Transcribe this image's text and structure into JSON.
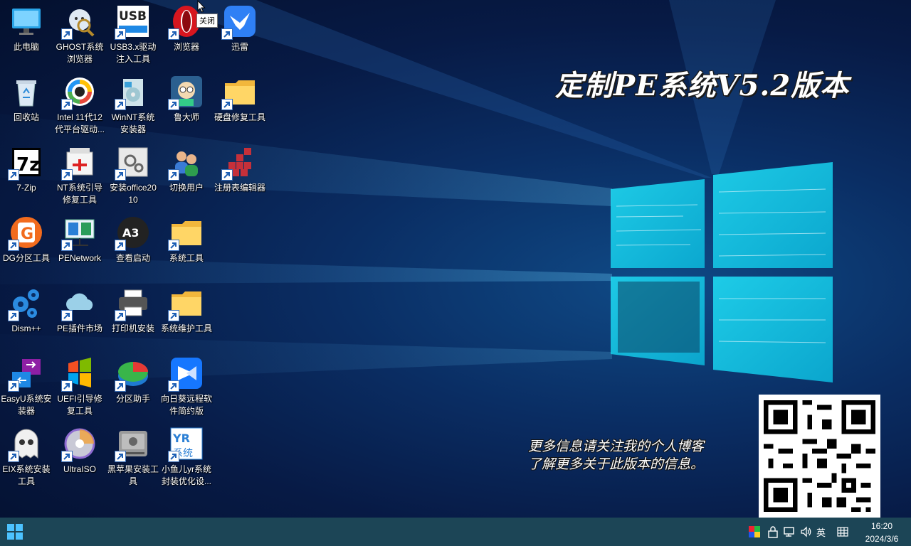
{
  "wallpaper": {
    "title": "定制PE系统V5.2版本",
    "blog_line1": "更多信息请关注我的个人博客",
    "blog_line2": "了解更多关于此版本的信息。"
  },
  "tooltip": "关闭",
  "desktop_icons": [
    {
      "label": "此电脑",
      "icon": "monitor-icon"
    },
    {
      "label": "GHOST系统浏览器",
      "icon": "ghost-explorer-icon"
    },
    {
      "label": "USB3.x驱动注入工具",
      "icon": "usb3-icon"
    },
    {
      "label": "浏览器",
      "icon": "opera-icon"
    },
    {
      "label": "迅雷",
      "icon": "thunder-icon"
    },
    {
      "label": "回收站",
      "icon": "recycle-bin-icon"
    },
    {
      "label": "Intel 11代12代平台驱动...",
      "icon": "intel-driver-icon"
    },
    {
      "label": "WinNT系统安装器",
      "icon": "winnt-setup-icon"
    },
    {
      "label": "鲁大师",
      "icon": "ludashi-icon"
    },
    {
      "label": "硬盘修复工具",
      "icon": "folder-icon"
    },
    {
      "label": "7-Zip",
      "icon": "7zip-icon"
    },
    {
      "label": "NT系统引导修复工具",
      "icon": "boot-repair-icon"
    },
    {
      "label": "安装office2010",
      "icon": "office-setup-icon"
    },
    {
      "label": "切换用户",
      "icon": "switch-user-icon"
    },
    {
      "label": "注册表编辑器",
      "icon": "regedit-icon"
    },
    {
      "label": "DG分区工具",
      "icon": "diskgenius-icon"
    },
    {
      "label": "PENetwork",
      "icon": "penetwork-icon"
    },
    {
      "label": "查看启动",
      "icon": "bootice-icon"
    },
    {
      "label": "系统工具",
      "icon": "folder-icon"
    },
    {
      "label": "Dism++",
      "icon": "dism-icon"
    },
    {
      "label": "PE插件市场",
      "icon": "cloud-icon"
    },
    {
      "label": "打印机安装",
      "icon": "printer-icon"
    },
    {
      "label": "系统维护工具",
      "icon": "folder-icon"
    },
    {
      "label": "EasyU系统安装器",
      "icon": "easyu-icon"
    },
    {
      "label": "UEFI引导修复工具",
      "icon": "uefi-repair-icon"
    },
    {
      "label": "分区助手",
      "icon": "partition-assistant-icon"
    },
    {
      "label": "向日葵远程软件简约版",
      "icon": "sunlogin-icon"
    },
    {
      "label": "EIX系统安装工具",
      "icon": "eix-ghost-icon"
    },
    {
      "label": "UltraISO",
      "icon": "ultraiso-icon"
    },
    {
      "label": "黑苹果安装工具",
      "icon": "hackintosh-icon"
    },
    {
      "label": "小鱼儿yr系统封装优化设...",
      "icon": "yr-system-icon"
    }
  ],
  "taskbar": {
    "ime_label": "英",
    "time": "16:20",
    "date": "2024/3/6",
    "accent": "#1c4556"
  }
}
